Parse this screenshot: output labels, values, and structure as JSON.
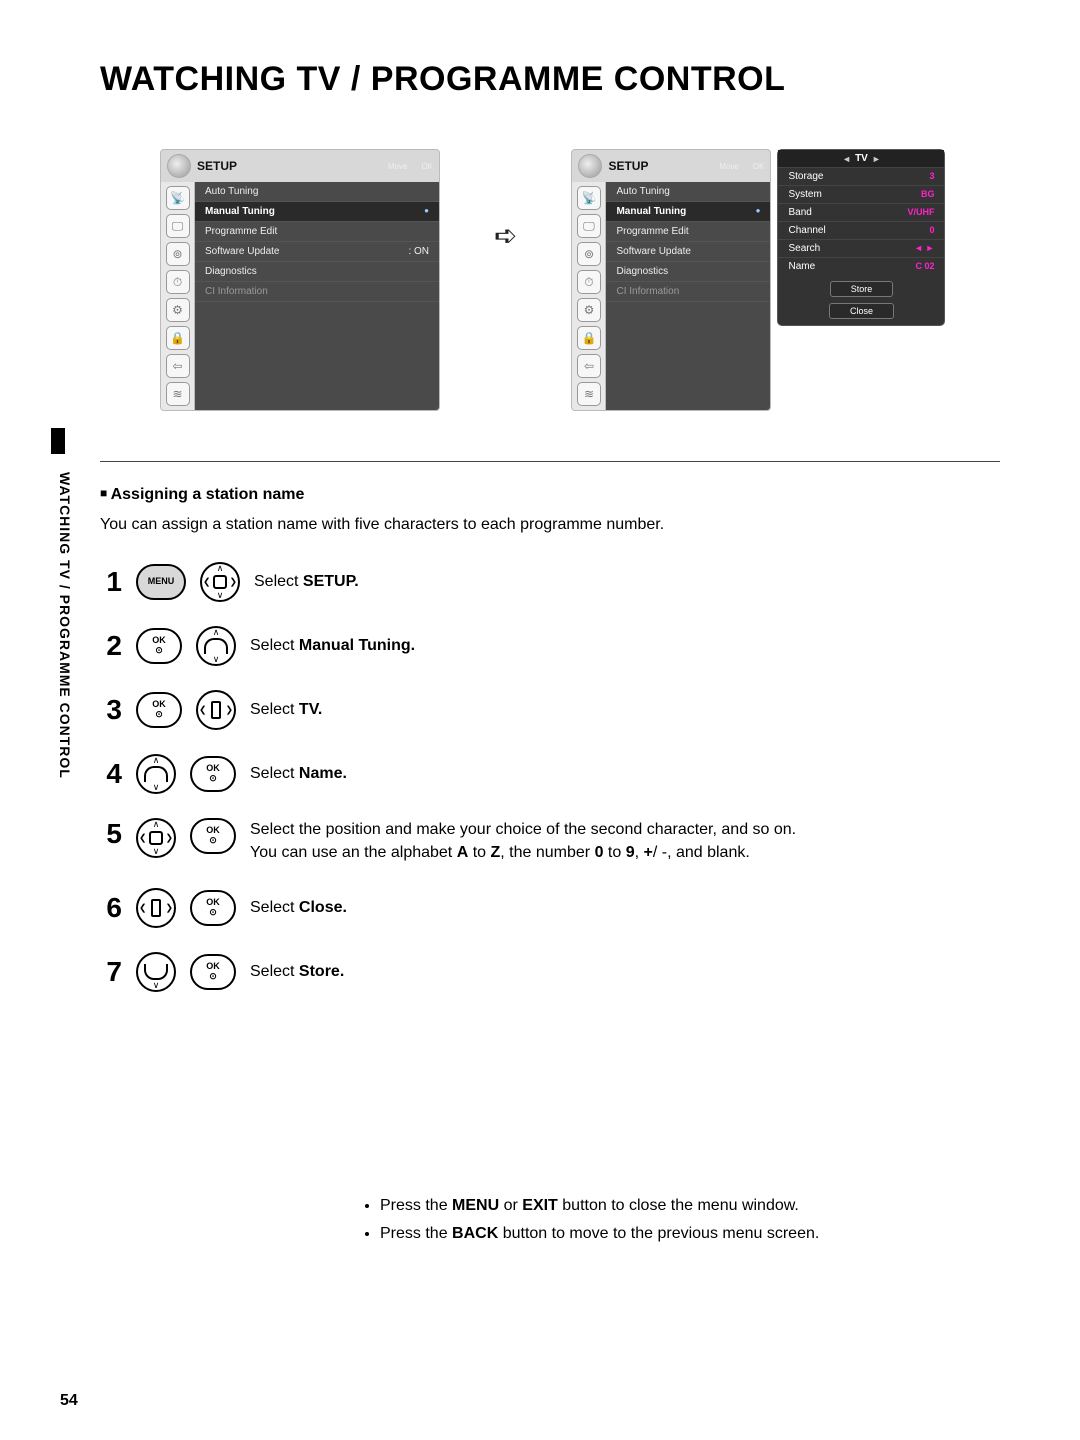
{
  "title": "WATCHING TV / PROGRAMME CONTROL",
  "side_label": "WATCHING TV / PROGRAMME CONTROL",
  "page_number": "54",
  "menu": {
    "title": "SETUP",
    "hint_move": "Move",
    "hint_ok": "OK",
    "items": {
      "auto_tuning": "Auto Tuning",
      "manual_tuning": "Manual Tuning",
      "programme_edit": "Programme Edit",
      "software_update": "Software Update",
      "software_update_state": ": ON",
      "diagnostics": "Diagnostics",
      "ci_info": "CI Information"
    }
  },
  "tune": {
    "header_label": "TV",
    "rows": {
      "storage_k": "Storage",
      "storage_v": "3",
      "system_k": "System",
      "system_v": "BG",
      "band_k": "Band",
      "band_v": "V/UHF",
      "channel_k": "Channel",
      "channel_v": "0",
      "search_k": "Search",
      "search_v": "◄ ►",
      "name_k": "Name",
      "name_v": "C 02"
    },
    "store_btn": "Store",
    "close_btn": "Close"
  },
  "section": {
    "heading": "Assigning a station name",
    "lead": "You can assign a station name with five characters to each programme number."
  },
  "buttons": {
    "menu": "MENU",
    "ok": "OK\n⊙"
  },
  "steps": {
    "s1_pre": "Select ",
    "s1_b": "SETUP.",
    "s2_pre": "Select ",
    "s2_b": "Manual Tuning.",
    "s3_pre": "Select ",
    "s3_b": "TV.",
    "s4_pre": "Select ",
    "s4_b": "Name.",
    "s5_l1a": "Select the position and make your choice of the second character, and so on.",
    "s5_l2a": "You can use an the alphabet ",
    "s5_l2b": "A",
    "s5_l2c": " to ",
    "s5_l2d": "Z",
    "s5_l2e": ", the number ",
    "s5_l2f": "0",
    "s5_l2g": " to ",
    "s5_l2h": "9",
    "s5_l2i": ", ",
    "s5_l2j": "+",
    "s5_l2k": "/ -, and blank.",
    "s6_pre": "Select ",
    "s6_b": "Close.",
    "s7_pre": "Select ",
    "s7_b": "Store."
  },
  "foot": {
    "f1a": "Press the ",
    "f1b": "MENU",
    "f1c": " or ",
    "f1d": "EXIT",
    "f1e": " button to close the menu window.",
    "f2a": "Press the ",
    "f2b": "BACK",
    "f2c": "  button to move to the previous menu screen."
  }
}
